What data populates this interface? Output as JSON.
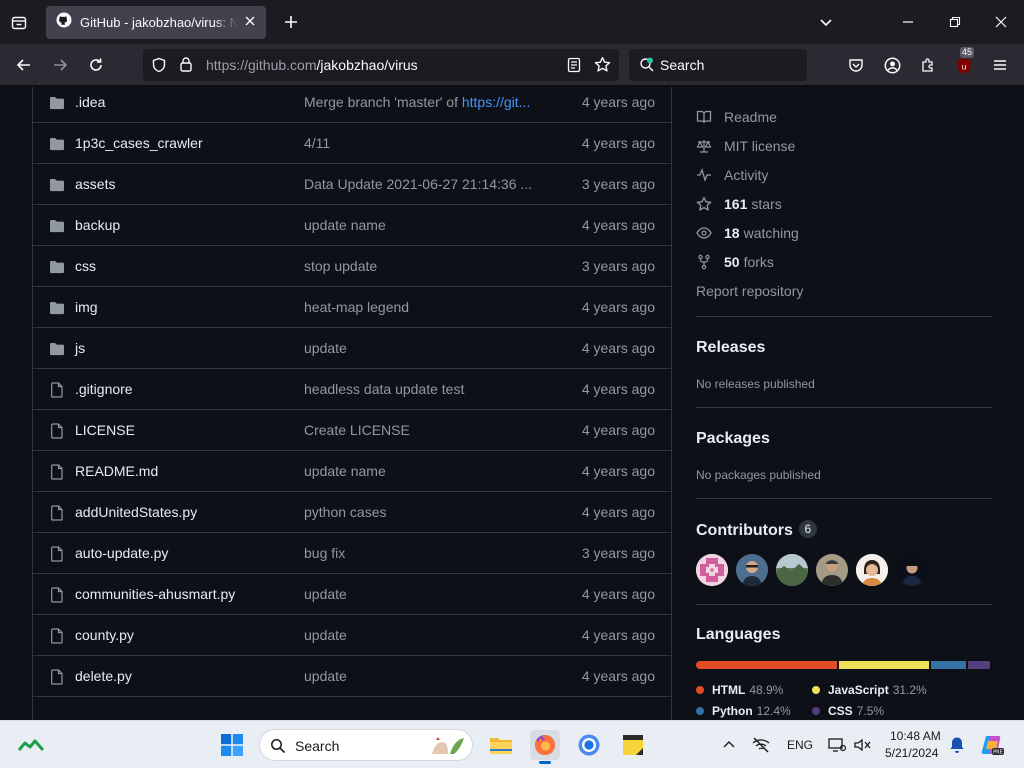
{
  "browser": {
    "tab_title": "GitHub - jakobzhao/virus: Nova",
    "url_host": "https://github.com",
    "url_path": "/jakobzhao/virus",
    "search_label": "Search",
    "extension_badge": "45"
  },
  "files": [
    {
      "type": "folder",
      "name": ".idea",
      "message": "Merge branch 'master' of ",
      "message_link": "https://git...",
      "age": "4 years ago"
    },
    {
      "type": "folder",
      "name": "1p3c_cases_crawler",
      "message": "4/11",
      "age": "4 years ago"
    },
    {
      "type": "folder",
      "name": "assets",
      "message": "Data Update 2021-06-27 21:14:36 ...",
      "age": "3 years ago"
    },
    {
      "type": "folder",
      "name": "backup",
      "message": "update name",
      "age": "4 years ago"
    },
    {
      "type": "folder",
      "name": "css",
      "message": "stop update",
      "age": "3 years ago"
    },
    {
      "type": "folder",
      "name": "img",
      "message": "heat-map legend",
      "age": "4 years ago"
    },
    {
      "type": "folder",
      "name": "js",
      "message": "update",
      "age": "4 years ago"
    },
    {
      "type": "file",
      "name": ".gitignore",
      "message": "headless data update test",
      "age": "4 years ago"
    },
    {
      "type": "file",
      "name": "LICENSE",
      "message": "Create LICENSE",
      "age": "4 years ago"
    },
    {
      "type": "file",
      "name": "README.md",
      "message": "update name",
      "age": "4 years ago"
    },
    {
      "type": "file",
      "name": "addUnitedStates.py",
      "message": "python cases",
      "age": "4 years ago"
    },
    {
      "type": "file",
      "name": "auto-update.py",
      "message": "bug fix",
      "age": "3 years ago"
    },
    {
      "type": "file",
      "name": "communities-ahusmart.py",
      "message": "update",
      "age": "4 years ago"
    },
    {
      "type": "file",
      "name": "county.py",
      "message": "update",
      "age": "4 years ago"
    },
    {
      "type": "file",
      "name": "delete.py",
      "message": "update",
      "age": "4 years ago"
    }
  ],
  "about": {
    "readme": "Readme",
    "license": "MIT license",
    "activity": "Activity",
    "stars_count": "161",
    "stars_label": "stars",
    "watching_count": "18",
    "watching_label": "watching",
    "forks_count": "50",
    "forks_label": "forks",
    "report": "Report repository"
  },
  "releases": {
    "title": "Releases",
    "subtitle": "No releases published"
  },
  "packages": {
    "title": "Packages",
    "subtitle": "No packages published"
  },
  "contributors": {
    "title": "Contributors",
    "count": "6"
  },
  "languages": {
    "title": "Languages",
    "items": [
      {
        "name": "HTML",
        "percent": "48.9%",
        "value": 48.9,
        "color": "#e34c26"
      },
      {
        "name": "JavaScript",
        "percent": "31.2%",
        "value": 31.2,
        "color": "#f1e05a"
      },
      {
        "name": "Python",
        "percent": "12.4%",
        "value": 12.4,
        "color": "#3572a5"
      },
      {
        "name": "CSS",
        "percent": "7.5%",
        "value": 7.5,
        "color": "#563d7c"
      }
    ]
  },
  "taskbar": {
    "search_label": "Search",
    "language": "ENG",
    "time": "10:48 AM",
    "date": "5/21/2024"
  },
  "colors": {
    "page_bg": "#0d1117",
    "border": "#30363d",
    "link": "#4493f8",
    "muted": "#9198a1"
  }
}
